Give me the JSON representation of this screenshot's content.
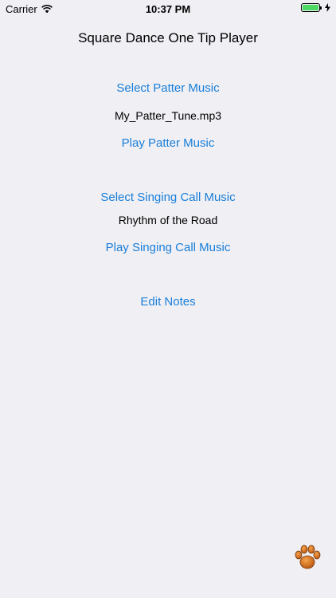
{
  "status_bar": {
    "carrier": "Carrier",
    "time": "10:37 PM",
    "icons": [
      "wifi-icon",
      "battery-icon",
      "charging-bolt-icon"
    ]
  },
  "screen": {
    "title": "Square Dance One Tip Player"
  },
  "patter": {
    "select_label": "Select Patter Music",
    "file_name": "My_Patter_Tune.mp3",
    "play_label": "Play Patter Music"
  },
  "singing_call": {
    "select_label": "Select Singing Call Music",
    "song_name": "Rhythm of the Road",
    "play_label": "Play Singing Call Music"
  },
  "notes": {
    "edit_label": "Edit Notes"
  },
  "colors": {
    "link": "#1a7fd9",
    "background": "#efeff4",
    "paw": "#e07a1f",
    "battery": "#4cd964"
  },
  "footer": {
    "icon": "paw-icon"
  }
}
